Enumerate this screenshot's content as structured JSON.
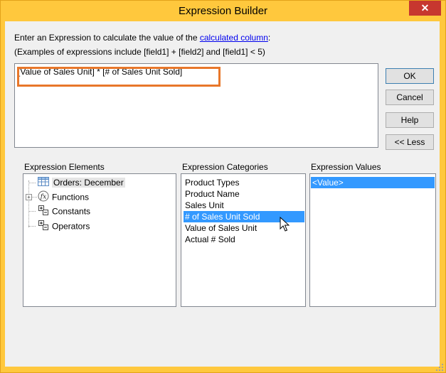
{
  "window": {
    "title": "Expression Builder",
    "close_glyph": "✕",
    "accent_color": "#ffc83d",
    "close_color": "#c7372f"
  },
  "instructions": {
    "line1_before": "Enter an Expression to calculate the value of the ",
    "line1_link": "calculated column",
    "line1_after": ":",
    "line2": "(Examples of expressions include [field1] + [field2] and [field1] < 5)"
  },
  "expression": {
    "value": "[Value of Sales Unit] * [# of Sales Unit Sold]"
  },
  "buttons": {
    "ok": "OK",
    "cancel": "Cancel",
    "help": "Help",
    "less": "<< Less"
  },
  "elements": {
    "label": "Expression Elements",
    "items": [
      {
        "label": "Orders: December",
        "icon": "table-icon"
      },
      {
        "label": "Functions",
        "icon": "function-icon"
      },
      {
        "label": "Constants",
        "icon": "constants-icon"
      },
      {
        "label": "Operators",
        "icon": "operators-icon"
      }
    ]
  },
  "categories": {
    "label": "Expression Categories",
    "items": [
      "Product Types",
      "Product Name",
      "Sales Unit",
      "# of Sales Unit Sold",
      "Value of Sales Unit",
      "Actual # Sold"
    ],
    "selected": "# of Sales Unit Sold"
  },
  "values": {
    "label": "Expression Values",
    "items": [
      "<Value>"
    ],
    "selected": "<Value>"
  }
}
